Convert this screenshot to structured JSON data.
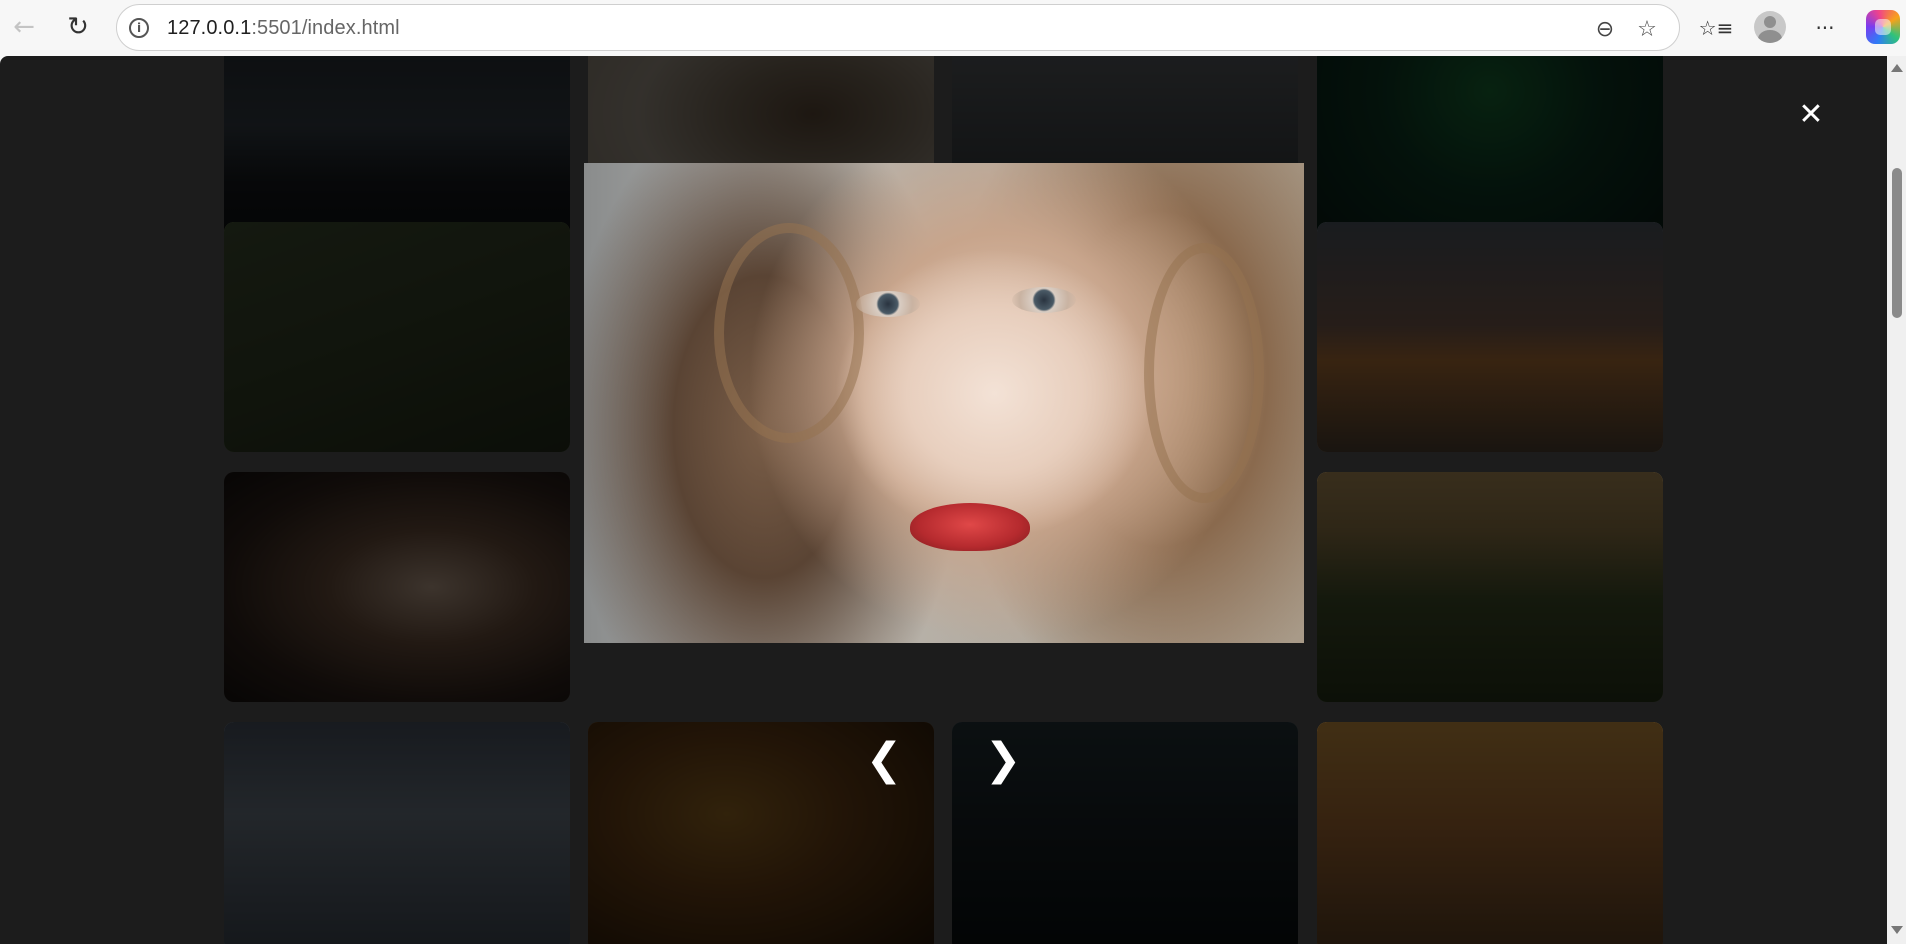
{
  "browser": {
    "url_host": "127.0.0.1",
    "url_rest": ":5501/index.html",
    "icons": {
      "back": "arrow-left-icon",
      "reload": "reload-icon",
      "site_info": "info-icon",
      "zoom": "zoom-out-icon",
      "favorite": "star-icon",
      "favorites_list": "favorites-icon",
      "profile": "profile-icon",
      "more": "more-icon",
      "copilot": "copilot-icon"
    },
    "glyphs": {
      "back": "←",
      "reload": "↻",
      "info": "i",
      "zoom": "⊖",
      "favorite": "☆",
      "favorites_list": "☆≡",
      "more": "···"
    }
  },
  "gallery": {
    "tile_subjects": [
      "dark-lake",
      "bear",
      "forest-fog",
      "aurora",
      "grass-bike",
      "rails-sunset",
      "woman-dim",
      "palms",
      "building",
      "fern",
      "escalator",
      "field-sunset"
    ]
  },
  "lightbox": {
    "close_label": "✕",
    "prev_label": "❮",
    "next_label": "❯",
    "image_subject": "portrait-woman-red-lips",
    "overlay_color": "#1c1c1c"
  }
}
